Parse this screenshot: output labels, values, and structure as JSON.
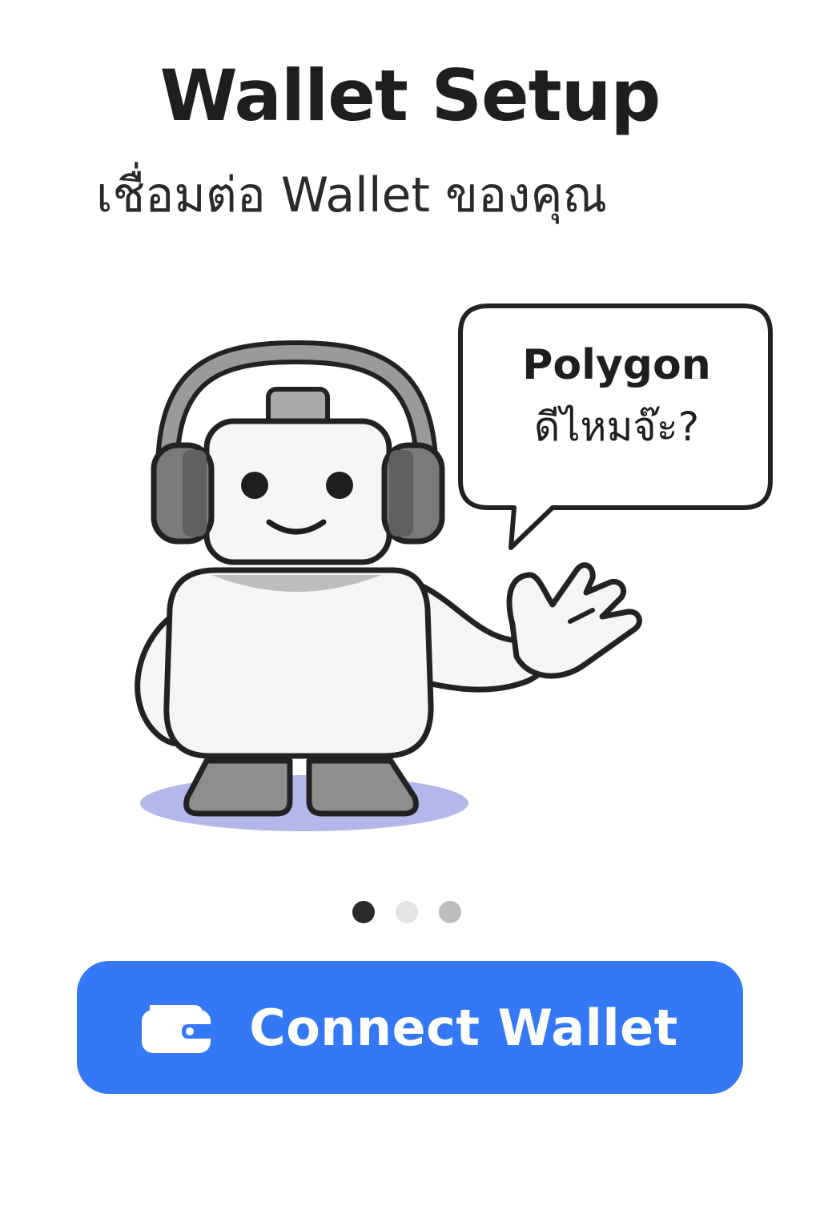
{
  "header": {
    "title": "Wallet Setup",
    "subtitle": "เชื่อมต่อ Wallet ของคุณ"
  },
  "illustration": {
    "bubble_line1": "Polygon",
    "bubble_line2": "ดีไหมจ๊ะ?"
  },
  "pagination": {
    "count": 3,
    "active_index": 0
  },
  "cta": {
    "label": "Connect Wallet",
    "icon": "wallet-icon"
  },
  "colors": {
    "accent": "#3478f6",
    "shadow": "#b4b7ea",
    "robot_gray": "#8a8a8a"
  }
}
